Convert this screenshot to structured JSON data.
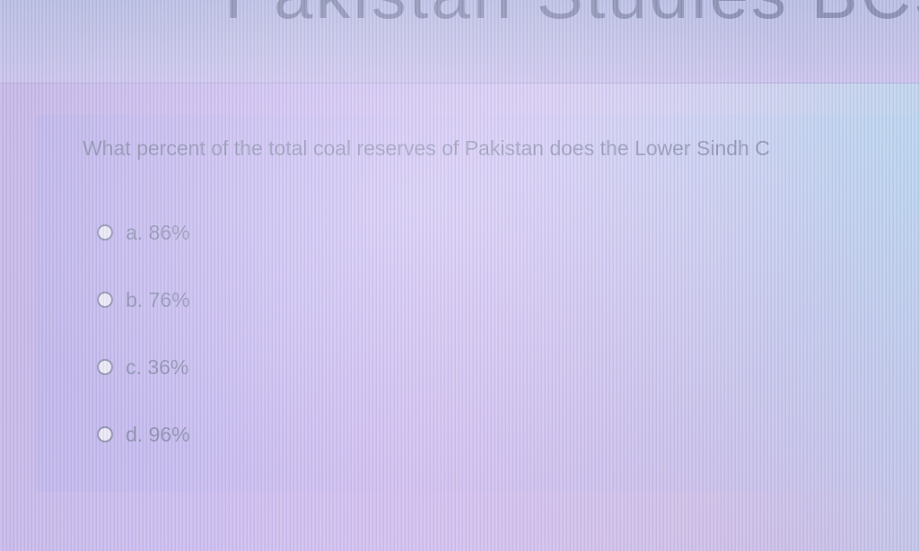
{
  "header": {
    "heading": "Pakistan Studies BCSF"
  },
  "question": {
    "text": "What percent of the total coal reserves of Pakistan does the Lower Sindh C",
    "options": [
      {
        "label": "a. 86%"
      },
      {
        "label": "b. 76%"
      },
      {
        "label": "c. 36%"
      },
      {
        "label": "d. 96%"
      }
    ]
  },
  "colors": {
    "text": "#8b90ae",
    "background": "#cdbef0",
    "accent": "#b7d7ec"
  }
}
